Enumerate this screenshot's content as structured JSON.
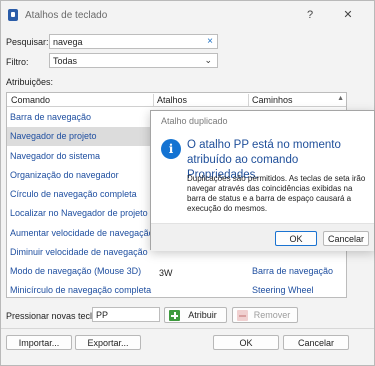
{
  "window": {
    "title": "Atalhos de teclado",
    "help_glyph": "?",
    "close_glyph": "✕"
  },
  "search": {
    "label": "Pesquisar:",
    "value": "navega",
    "clear_glyph": "×"
  },
  "filter": {
    "label": "Filtro:",
    "value": "Todas",
    "chevron": "⌄"
  },
  "assignments": {
    "label": "Atribuições:",
    "columns": [
      "Comando",
      "Atalhos",
      "Caminhos"
    ],
    "rows": [
      {
        "command": "Barra de navegação",
        "shortcut": "",
        "path": ""
      },
      {
        "command": "Navegador de projeto",
        "shortcut": "",
        "path": "",
        "selected": true
      },
      {
        "command": "Navegador do sistema",
        "shortcut": "",
        "path": ""
      },
      {
        "command": "Organização do navegador",
        "shortcut": "",
        "path": ""
      },
      {
        "command": "Círculo de navegação completa",
        "shortcut": "",
        "path": ""
      },
      {
        "command": "Localizar no Navegador de projeto",
        "shortcut": "",
        "path": ""
      },
      {
        "command": "Aumentar velocidade de navegação",
        "shortcut": "",
        "path": ""
      },
      {
        "command": "Diminuir velocidade de navegação",
        "shortcut": "",
        "path": ""
      },
      {
        "command": "Modo de navegação (Mouse 3D)",
        "shortcut": "3W",
        "path": "Barra de navegação"
      },
      {
        "command": "Minicírculo de navegação completa",
        "shortcut": "",
        "path": "Steering Wheel"
      }
    ]
  },
  "press_keys": {
    "label": "Pressionar novas teclas:",
    "value": "PP"
  },
  "buttons": {
    "assign": "Atribuir",
    "remove": "Remover",
    "import": "Importar...",
    "export": "Exportar...",
    "ok": "OK",
    "cancel": "Cancelar"
  },
  "popup": {
    "title": "Atalho duplicado",
    "info_glyph": "i",
    "heading": "O atalho PP está no momento atribuído ao comando Propriedades.",
    "body": "Duplicações são permitidos. As teclas de seta irão navegar através das coincidências exibidas na barra de status e a barra de espaço causará a execução do mesmos.",
    "ok": "OK",
    "cancel": "Cancelar"
  },
  "colors": {
    "accent": "#1473d2",
    "link_text": "#1f4fa0",
    "selected_row": "#dcdcdc",
    "assign_icon": "#3e9a3e"
  }
}
